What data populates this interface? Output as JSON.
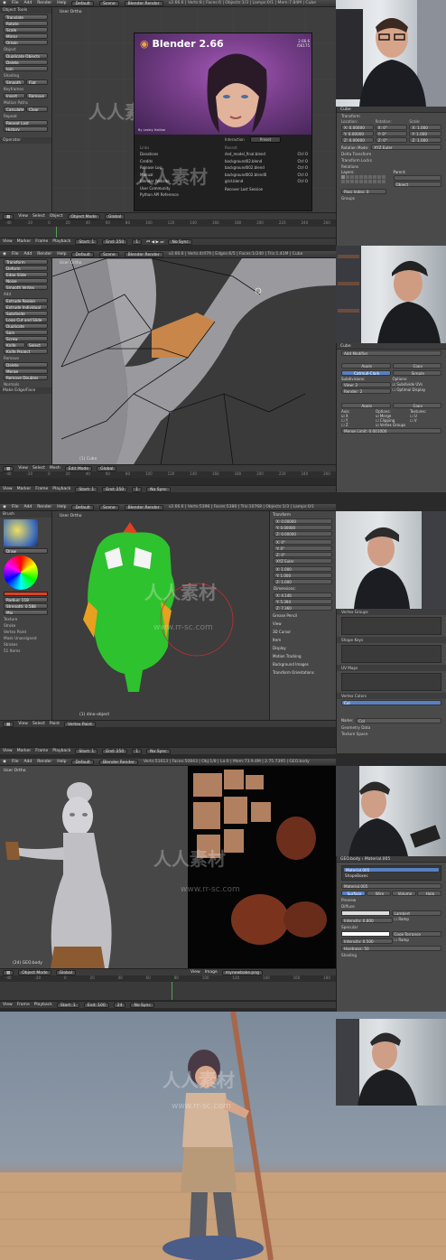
{
  "panel1": {
    "header_menus": [
      "File",
      "Add",
      "Render",
      "Help"
    ],
    "layout": "Default",
    "scene": "Scene",
    "engine": "Blender Render",
    "stats": "v2.66.6 | Verts:8 | Faces:6 | Objects:1/3 | Lamps:0/1 | Mem:7.84M | Cube",
    "tools_title": "Object Tools",
    "tools": [
      "Translate",
      "Rotate",
      "Scale",
      "Mirror",
      "Origin",
      "Object",
      "Duplicate Objects",
      "Delete",
      "Join",
      "Shading",
      "Smooth",
      "Flat",
      "Keyframes",
      "Insert",
      "Remove",
      "Motion Paths",
      "Calculate",
      "Clear",
      "Repeat",
      "Repeat Last",
      "History"
    ],
    "operator_label": "Operator",
    "viewport_label": "User Ortho",
    "splash": {
      "title": "Blender 2.66",
      "version": "2.66.6",
      "build": "r56175",
      "credit": "By Lesley Hatiloe",
      "interaction_label": "Interaction",
      "interaction_value": "Preset",
      "links_title": "Links",
      "links": [
        "Donations",
        "Credits",
        "Release Log",
        "Manual",
        "Blender Website",
        "User Community",
        "Python API Reference"
      ],
      "recent_title": "Recent",
      "recent": [
        {
          "name": "dvd_model_final.blend",
          "key": "Ctrl O"
        },
        {
          "name": "background02.blend",
          "key": "Ctrl O"
        },
        {
          "name": "background002.blend",
          "key": "Ctrl O"
        },
        {
          "name": "background002.blend0",
          "key": "Ctrl O"
        },
        {
          "name": "grid.blend",
          "key": "Ctrl O"
        }
      ],
      "recover": "Recover Last Session"
    },
    "bottom_menus": [
      "View",
      "Select",
      "Object"
    ],
    "mode": "Object Mode",
    "pivot": "Global",
    "props_object": "Cube",
    "props_sections": [
      "Transform",
      "Location:",
      "Rotation:",
      "Scale:"
    ],
    "loc": [
      "X: 0.00000",
      "Y: 0.00000",
      "Z: 0.00000"
    ],
    "rot": [
      "X: 0°",
      "Y: 0°",
      "Z: 0°"
    ],
    "scale": [
      "X: 1.000",
      "Y: 1.000",
      "Z: 1.000"
    ],
    "rotation_mode_label": "Rotation Mode:",
    "rotation_mode": "XYZ Euler",
    "subsections": [
      "Delta Transform",
      "Transform Locks",
      "Relations"
    ],
    "layers_label": "Layers:",
    "parent_label": "Parent:",
    "parent_value": "Object",
    "pass_index": "Pass Index: 0",
    "groups": "Groups"
  },
  "timeline1": {
    "menus": [
      "View",
      "Marker",
      "Frame",
      "Playback"
    ],
    "start": "Start: 1",
    "end": "End: 250",
    "frame": "1",
    "sync": "No Sync",
    "ruler": [
      "-40",
      "-20",
      "0",
      "20",
      "40",
      "60",
      "80",
      "100",
      "120",
      "140",
      "160",
      "180",
      "200",
      "220",
      "240",
      "260"
    ]
  },
  "panel2": {
    "tools": [
      "Transform",
      "Deform",
      "Edge Slide",
      "Noise",
      "Smooth Vertex",
      "Add",
      "Extrude Region",
      "Extrude Individual",
      "Subdivide",
      "Loop Cut and Slide",
      "Duplicate",
      "Spin",
      "Screw",
      "Knife",
      "Select",
      "Knife Project",
      "Remove",
      "Delete",
      "Merge",
      "Remove Doubles",
      "Normals"
    ],
    "operator_label": "Make Edge/Face",
    "viewport_label": "User Ortho",
    "object_label": "(1) Cube",
    "stats": "v2.66.6 | Verts:4/479 | Edges:6/5 | Faces:1/240 | Tris:1.41M | Cube",
    "mode": "Edit Mode",
    "pivot": "Global",
    "props_object": "Cube",
    "add_modifier": "Add Modifier",
    "modifier_apply": "Apply",
    "modifier_copy": "Copy",
    "subdiv_type": [
      "Catmull-Clark",
      "Simple"
    ],
    "subdiv_labels": [
      "Subdivisions:",
      "Options:"
    ],
    "subdiv_view": "View: 2",
    "subdiv_render": "Render: 2",
    "subdiv_opts": [
      "Subdivide UVs",
      "Optimal Display"
    ],
    "mirror_axis": "Axis:",
    "mirror_options": [
      "Options:",
      "Merge",
      "Clipping",
      "Vertex Groups"
    ],
    "mirror_textures": "Textures:",
    "merge_limit": "Merge Limit: 0.001000"
  },
  "timeline2": {
    "start": "Start: 1",
    "end": "End: 250",
    "frame": "1",
    "sync": "No Sync"
  },
  "panel3": {
    "stats": "v2.66.6 | Verts:5396 | Faces:5386 | Tris:10768 | Objects:1/3 | Lamps:0/1",
    "brush_label": "Brush",
    "draw_label": "Draw",
    "radius": "Radius: 118",
    "strength": "Strength: 0.588",
    "blend": "Mix",
    "tool_sections": [
      "Texture",
      "Stroke",
      "Vertex Paint"
    ],
    "paint_mask": "Mask Unassigned",
    "stroke_info": "Strokes",
    "frames": "51 Items",
    "viewport_label": "User Ortho",
    "object_label": "(1) dino-object",
    "mode": "Vertex Paint",
    "npanel": {
      "transform": "Transform",
      "location": [
        "X: 0.00000",
        "Y: 0.00000",
        "Z: 0.00000"
      ],
      "rotation": [
        "X: 0°",
        "Y: 0°",
        "Z: 0°"
      ],
      "rot_mode": "XYZ Euler",
      "scale": [
        "X: 1.000",
        "Y: 1.000",
        "Z: 1.000"
      ],
      "dims_label": "Dimensions:",
      "dims": [
        "X: 4.146",
        "Y: 5.394",
        "Z: 7.360"
      ],
      "sections": [
        "Grease Pencil",
        "View",
        "3D Cursor",
        "Item",
        "Display",
        "Motion Tracking",
        "Background Images",
        "Transform Orientations"
      ]
    },
    "props": {
      "vertex_groups": "Vertex Groups",
      "shape_keys": "Shape Keys",
      "uv_maps": "UV Maps",
      "vertex_colors": "Vertex Colors",
      "col_name": "Col",
      "name_label": "Name:",
      "geometry": "Geometry Data",
      "texture_label": "Texture Space"
    }
  },
  "timeline3": {
    "start": "Start: 1",
    "end": "End: 250",
    "frame": "1",
    "sync": "No Sync"
  },
  "panel4": {
    "stats": "Verts:51613 | Faces:50843 | Obj:1/8 | La:0 | Mem:73.9.4M | 2.75.7395 | GEO.body",
    "viewport_label": "User Ortho",
    "object_label": "(24) GEO.body",
    "mode": "Object Mode",
    "pivot": "Global",
    "uv_menus": [
      "View",
      "Image"
    ],
    "uv_image": "mynewbake.png",
    "props_object": "GEO.body",
    "material": "Material.005",
    "materials": [
      "Material.005",
      "ShapeBoxes"
    ],
    "tabs": [
      "Surface",
      "Wire",
      "Volume",
      "Halo"
    ],
    "preview": "Preview",
    "diffuse": "Diffuse",
    "diffuse_shader": "Lambert",
    "intensity1": "Intensity: 0.800",
    "ramp": "Ramp",
    "specular": "Specular",
    "spec_shader": "Cook-Torrance",
    "intensity2": "Intensity: 0.500",
    "hardness": "Hardness: 50",
    "shading": "Shading"
  },
  "timeline4": {
    "menus": [
      "View",
      "Frame",
      "Playback"
    ],
    "start": "Start: 1",
    "end": "End: 100",
    "frame": "24",
    "sync": "No Sync"
  },
  "watermark": {
    "brand": "人人素材",
    "url": "www.rr-sc.com"
  },
  "colors": {
    "accent": "#5680c2",
    "header": "#3e3e3e",
    "panel": "#4a4a4a",
    "viewport": "#3d3d3d"
  }
}
